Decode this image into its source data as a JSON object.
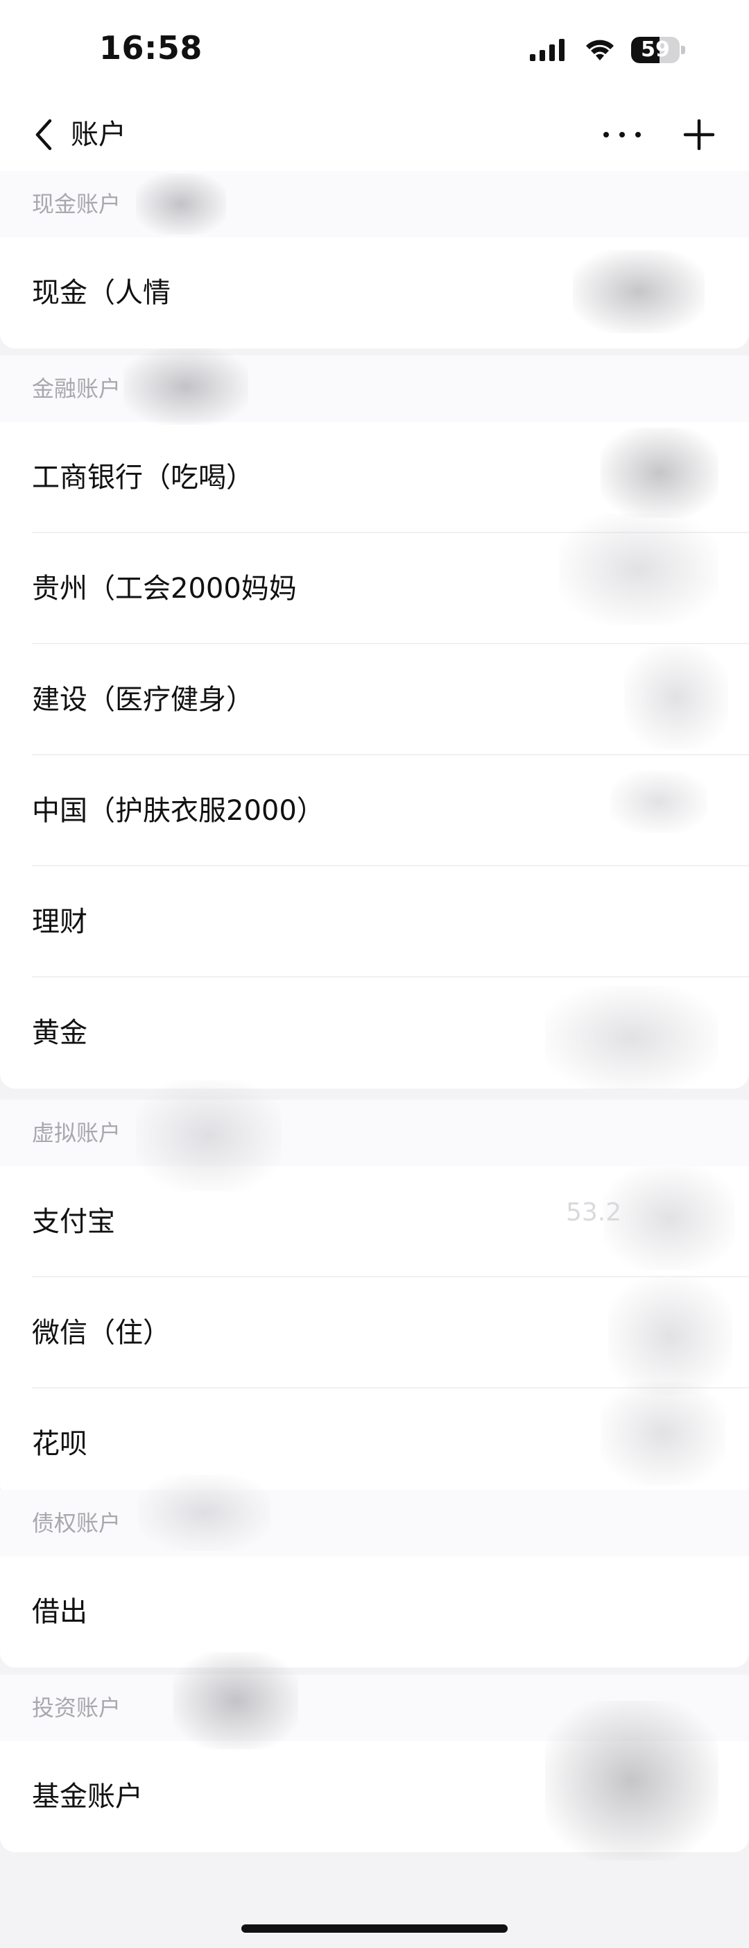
{
  "status_bar": {
    "time": "16:58",
    "battery_level": "59",
    "battery_fraction": 0.59
  },
  "nav": {
    "title": "账户",
    "back_icon": "chevron-left-icon",
    "more_icon": "ellipsis-icon",
    "add_icon": "plus-icon"
  },
  "sections": [
    {
      "title": "现金账户",
      "items": [
        {
          "label": "现金（人情"
        }
      ]
    },
    {
      "title": "金融账户",
      "items": [
        {
          "label": "工商银行（吃喝）"
        },
        {
          "label": "贵州（工会2000妈妈"
        },
        {
          "label": "建设（医疗健身）"
        },
        {
          "label": "中国（护肤衣服2000）"
        },
        {
          "label": "理财"
        },
        {
          "label": "黄金"
        }
      ]
    },
    {
      "title": "虚拟账户",
      "items": [
        {
          "label": "支付宝"
        },
        {
          "label": "微信（住）"
        },
        {
          "label": "花呗"
        }
      ]
    },
    {
      "title": "债权账户",
      "items": [
        {
          "label": "借出"
        }
      ]
    },
    {
      "title": "投资账户",
      "items": [
        {
          "label": "基金账户"
        }
      ]
    }
  ],
  "ghost_amount": "53.2"
}
